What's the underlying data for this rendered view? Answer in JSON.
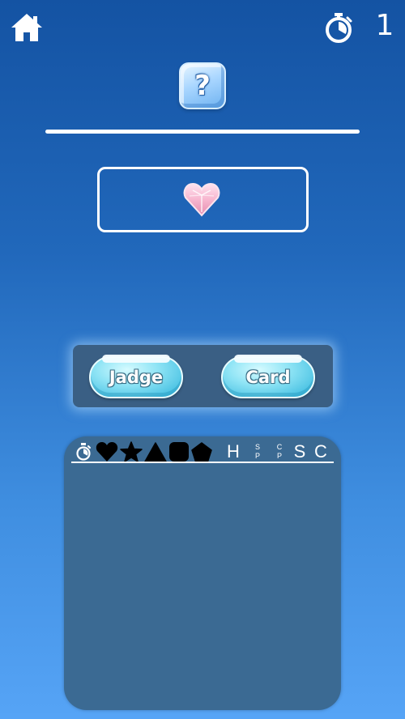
{
  "top_bar": {
    "home_icon": "home-icon",
    "timer_icon": "stopwatch-icon",
    "timer_value": "1"
  },
  "question": {
    "cube_symbol": "?",
    "icon": "ice-question-cube-icon"
  },
  "answer_box": {
    "gem_icon": "pink-heart-gem-icon"
  },
  "buttons": {
    "judge_label": "Jadge",
    "card_label": "Card"
  },
  "history": {
    "columns": [
      {
        "kind": "icon",
        "name": "stopwatch-icon"
      },
      {
        "kind": "icon",
        "name": "heart-icon"
      },
      {
        "kind": "icon",
        "name": "star-icon"
      },
      {
        "kind": "icon",
        "name": "triangle-icon"
      },
      {
        "kind": "icon",
        "name": "rounded-square-icon"
      },
      {
        "kind": "icon",
        "name": "pentagon-icon"
      },
      {
        "kind": "text",
        "label": "H"
      },
      {
        "kind": "stack",
        "top": "S",
        "bottom": "P"
      },
      {
        "kind": "stack",
        "top": "C",
        "bottom": "P"
      },
      {
        "kind": "text",
        "label": "S"
      },
      {
        "kind": "text",
        "label": "C"
      }
    ],
    "col_H": "H",
    "col_SP_top": "S",
    "col_SP_bottom": "P",
    "col_CP_top": "C",
    "col_CP_bottom": "P",
    "col_S": "S",
    "col_C": "C",
    "rows": []
  },
  "colors": {
    "bg_top": "#1453a3",
    "bg_bottom": "#56a4f6",
    "panel": "#3a5f84",
    "board": "#3b6a93",
    "ice": "#8fe4f5",
    "heart_gem": "#f6b8cf"
  }
}
